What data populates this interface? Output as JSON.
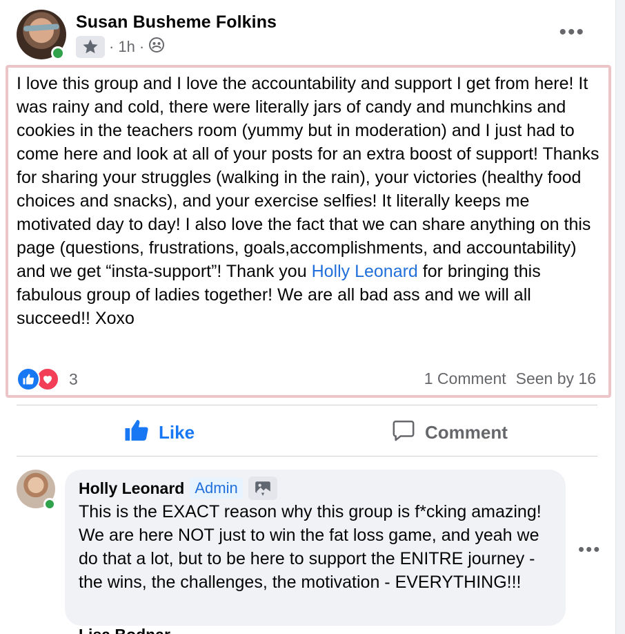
{
  "post": {
    "author": "Susan Busheme Folkins",
    "time": "1h",
    "meta_separator": "·",
    "body": [
      {
        "text": "I love this group and I love the accountability and support I get from here! It was rainy and cold, there were literally jars of candy and munchkins and cookies in the teachers room (yummy but in moderation) and I just had to come here and look at all of your posts for an extra boost of support! Thanks for sharing your struggles (walking in the rain), your victories (healthy food choices and snacks), and your exercise selfies! It literally keeps me motivated day to day! I also love the fact that we can share anything on this page (questions, frustrations, goals,accomplishments, and accountability) and we get “insta-support”! Thank you "
      },
      {
        "text": "Holly Leonard",
        "mention": true
      },
      {
        "text": " for bringing this fabulous group of ladies together! We are all bad ass and we will all succeed!! Xoxo"
      }
    ],
    "reaction_count": "3",
    "comments_label": "1 Comment",
    "seen_label": "Seen by 16"
  },
  "actions": {
    "like_label": "Like",
    "comment_label": "Comment"
  },
  "comment": {
    "author": "Holly Leonard",
    "badge": "Admin",
    "text": "This is the EXACT reason why this group is f*cking amazing! We are here NOT just to win the fat loss game, and yeah we do that a lot, but to be here to support the ENITRE journey - the wins, the challenges, the motivation - EVERYTHING!!!"
  },
  "next_comment": {
    "author_partial": "Lisa Bodnar"
  },
  "icons": {
    "audience": "group-icon",
    "badge": "star-badge-icon",
    "more": "more-horizontal-icon",
    "like": "thumbs-up-icon",
    "comment": "speech-bubble-icon",
    "photo": "photo-icon"
  },
  "colors": {
    "accent": "#1877f2",
    "mention": "#216fdb",
    "secondary_text": "#65676b",
    "love": "#f33e58",
    "online": "#31a24c",
    "highlight_border": "#ecc5c9"
  }
}
